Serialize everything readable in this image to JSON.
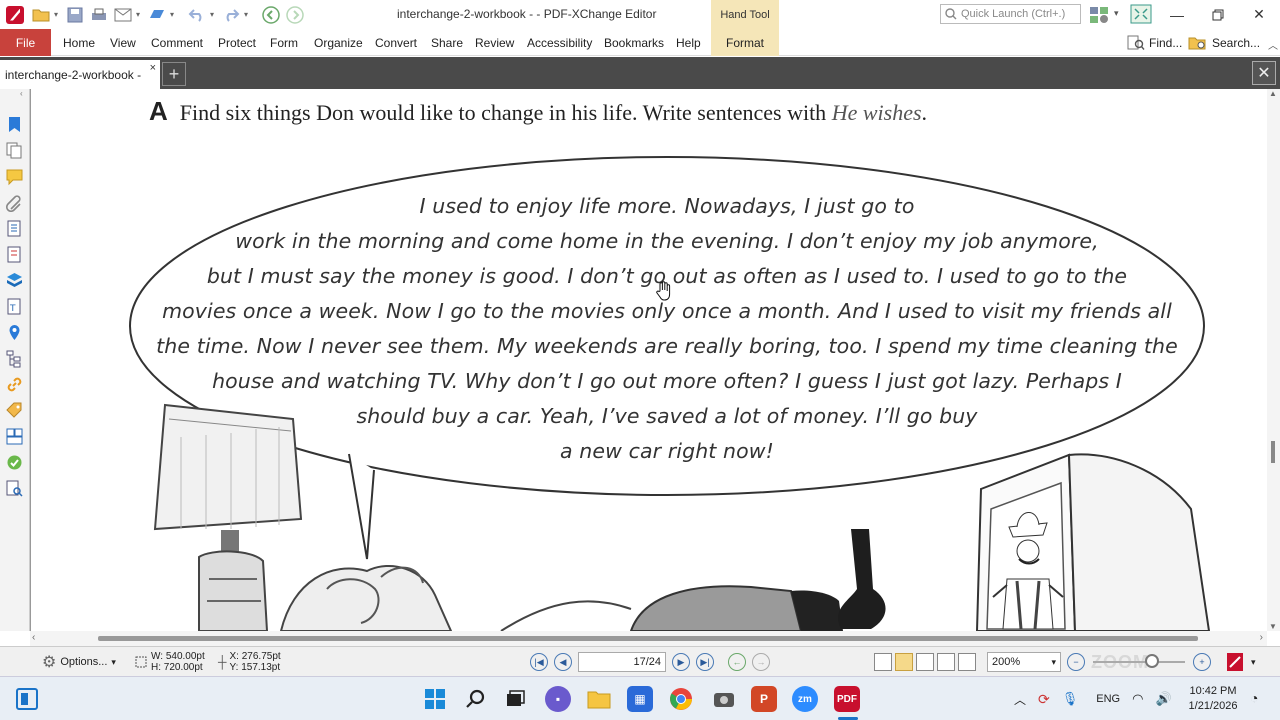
{
  "window": {
    "title": "interchange-2-workbook -  - PDF-XChange Editor",
    "context_tab_group": "Hand Tool",
    "quick_launch_placeholder": "Quick Launch (Ctrl+.)"
  },
  "menu": {
    "file": "File",
    "items": [
      "Home",
      "View",
      "Comment",
      "Protect",
      "Form",
      "Organize",
      "Convert",
      "Share",
      "Review",
      "Accessibility",
      "Bookmarks",
      "Help"
    ],
    "context_tab": "Format",
    "find": "Find...",
    "search": "Search..."
  },
  "tabs": {
    "document_tab": "interchange-2-workbook -",
    "close_glyph": "×",
    "new_tab_glyph": "+"
  },
  "document": {
    "exercise_letter": "A",
    "instruction": "Find six things Don would like to change in his life. Write sentences with ",
    "instruction_example": "He wishes",
    "instruction_end": ".",
    "bubble_lines": [
      "I used to enjoy life more. Nowadays, I just go to",
      "work in the morning and come home in the evening. I don’t enjoy my job anymore,",
      "but I must say the money is good. I don’t go out as often as I used to. I used to go to the",
      "movies once a week. Now I go to the movies only once a month. And I used to visit my friends all",
      "the time. Now I never see them. My weekends are really boring, too. I spend my time cleaning the",
      "house and watching TV. Why don’t I go out more often? I guess I just got lazy. Perhaps I",
      "should buy a car. Yeah, I’ve saved a lot of money. I’ll go buy",
      "a new car right now!"
    ]
  },
  "statusbar": {
    "options": "Options...",
    "width": "W: 540.00pt",
    "height": "H: 720.00pt",
    "x": "X: 276.75pt",
    "y": "Y: 157.13pt",
    "page_current": "17",
    "page_total": "/24",
    "zoom": "200%",
    "zoom_brand": "ZOOM"
  },
  "taskbar": {
    "language": "ENG",
    "time": "10:42 PM",
    "date": "1/21/2026"
  },
  "colors": {
    "file_tab": "#c8423c",
    "context_tab": "#f5e6b8",
    "tab_bar": "#4a4a4a",
    "accent_blue": "#2a6ab5"
  }
}
